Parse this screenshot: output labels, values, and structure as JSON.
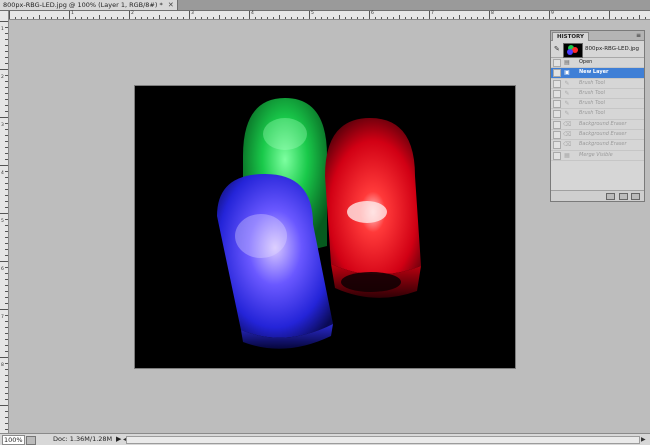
{
  "document": {
    "tab_title": "800px-RBG-LED.jpg @ 100% (Layer 1, RGB/8#) *",
    "close_glyph": "✕"
  },
  "rulers": {
    "top_labels": [
      "",
      "1",
      "2",
      "3",
      "4",
      "5",
      "6",
      "7",
      "8",
      "9"
    ],
    "left_labels": [
      "1",
      "2",
      "3",
      "4",
      "5",
      "6",
      "7",
      "8"
    ]
  },
  "image": {
    "description_colors": {
      "red": "#ff1a2a",
      "green": "#19d34a",
      "blue": "#3b3cff",
      "background": "#000000"
    }
  },
  "status": {
    "zoom": "100%",
    "doc_size": "Doc: 1.36M/1.28M",
    "arrow": "▶",
    "scroll_left": "◀",
    "scroll_right": "▶"
  },
  "history": {
    "tab_label": "HISTORY",
    "menu_glyph": "≡",
    "snapshot_name": "800px-RBG-LED.jpg",
    "items": [
      {
        "label": "Open",
        "icon": "document-icon",
        "state": "active"
      },
      {
        "label": "New Layer",
        "icon": "layer-icon",
        "state": "selected"
      },
      {
        "label": "Brush Tool",
        "icon": "brush-icon",
        "state": "dim"
      },
      {
        "label": "Brush Tool",
        "icon": "brush-icon",
        "state": "dim"
      },
      {
        "label": "Brush Tool",
        "icon": "brush-icon",
        "state": "dim"
      },
      {
        "label": "Brush Tool",
        "icon": "brush-icon",
        "state": "dim"
      },
      {
        "label": "Background Eraser",
        "icon": "eraser-icon",
        "state": "dim"
      },
      {
        "label": "Background Eraser",
        "icon": "eraser-icon",
        "state": "dim"
      },
      {
        "label": "Background Eraser",
        "icon": "eraser-icon",
        "state": "dim"
      },
      {
        "label": "Merge Visible",
        "icon": "merge-icon",
        "state": "dim"
      }
    ]
  }
}
